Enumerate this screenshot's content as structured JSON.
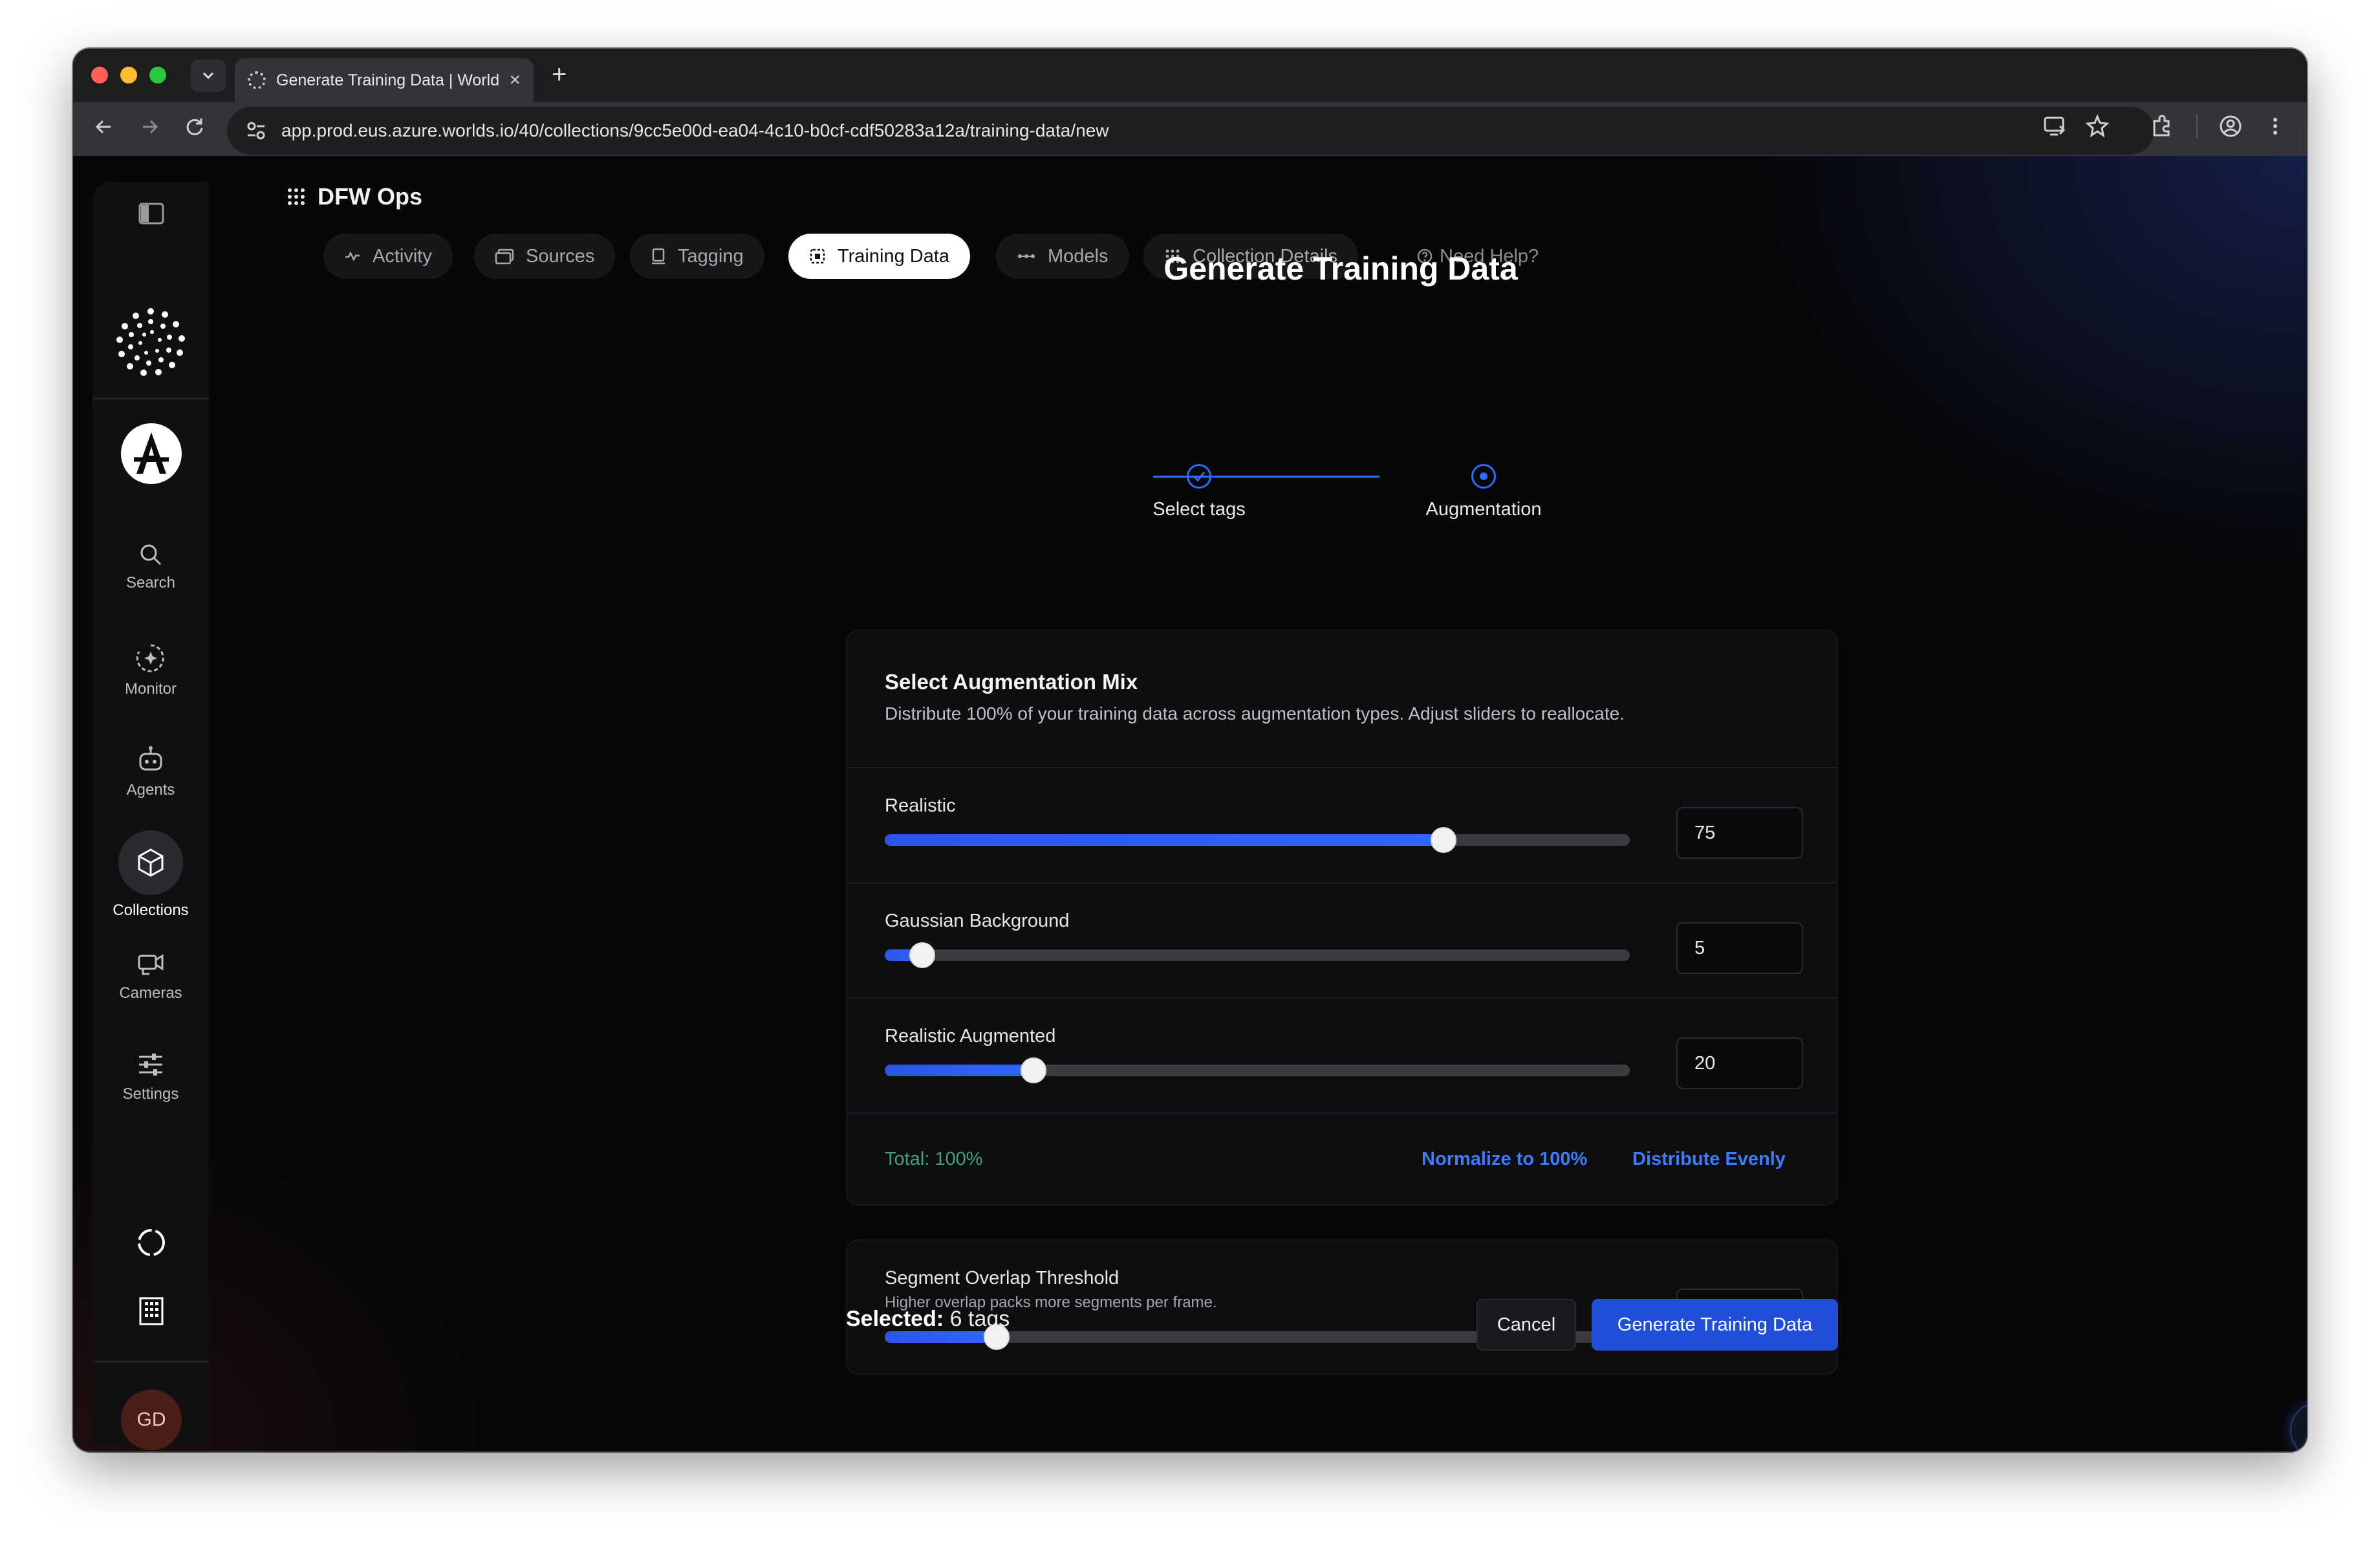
{
  "browser": {
    "tab_title": "Generate Training Data | Worlds",
    "url": "app.prod.eus.azure.worlds.io/40/collections/9cc5e00d-ea04-4c10-b0cf-cdf50283a12a/training-data/new",
    "traffic_light_colors": [
      "#ff5f57",
      "#febc2e",
      "#28c840"
    ]
  },
  "rail": {
    "items": [
      {
        "label": "Search",
        "icon": "search-icon"
      },
      {
        "label": "Monitor",
        "icon": "monitor-icon"
      },
      {
        "label": "Agents",
        "icon": "robot-icon"
      },
      {
        "label": "Collections",
        "icon": "cube-icon",
        "active": true
      },
      {
        "label": "Cameras",
        "icon": "camera-icon"
      },
      {
        "label": "Settings",
        "icon": "sliders-icon"
      }
    ],
    "avatar_initials": "GD"
  },
  "header": {
    "app_title": "DFW Ops"
  },
  "tabs": [
    {
      "label": "Activity",
      "icon": "activity-icon"
    },
    {
      "label": "Sources",
      "icon": "folder-icon"
    },
    {
      "label": "Tagging",
      "icon": "tag-icon"
    },
    {
      "label": "Training Data",
      "icon": "dataset-icon",
      "active": true
    },
    {
      "label": "Models",
      "icon": "nodes-icon"
    },
    {
      "label": "Collection Details",
      "icon": "grid-icon"
    },
    {
      "label": "Need Help?",
      "icon": "help-icon"
    }
  ],
  "page": {
    "title": "Generate Training Data",
    "steps": [
      "Select tags",
      "Augmentation"
    ]
  },
  "augmentation": {
    "title": "Select Augmentation Mix",
    "description": "Distribute 100% of your training data across augmentation types. Adjust sliders to reallocate.",
    "rows": [
      {
        "label": "Realistic",
        "value": "75",
        "percent": 75
      },
      {
        "label": "Gaussian Background",
        "value": "5",
        "percent": 5
      },
      {
        "label": "Realistic Augmented",
        "value": "20",
        "percent": 20
      }
    ],
    "total": "Total: 100%",
    "normalize_label": "Normalize to 100%",
    "distribute_label": "Distribute Evenly"
  },
  "segment": {
    "title": "Segment Overlap Threshold",
    "description": "Higher overlap packs more segments per frame.",
    "value": "15",
    "percent": 15
  },
  "footer": {
    "selected_label": "Selected:",
    "selected_value": "6 tags",
    "cancel_label": "Cancel",
    "generate_label": "Generate Training Data"
  },
  "colors": {
    "accent": "#2f6bff",
    "primary_button": "#1e4fd6",
    "total_text": "#45a07e"
  }
}
